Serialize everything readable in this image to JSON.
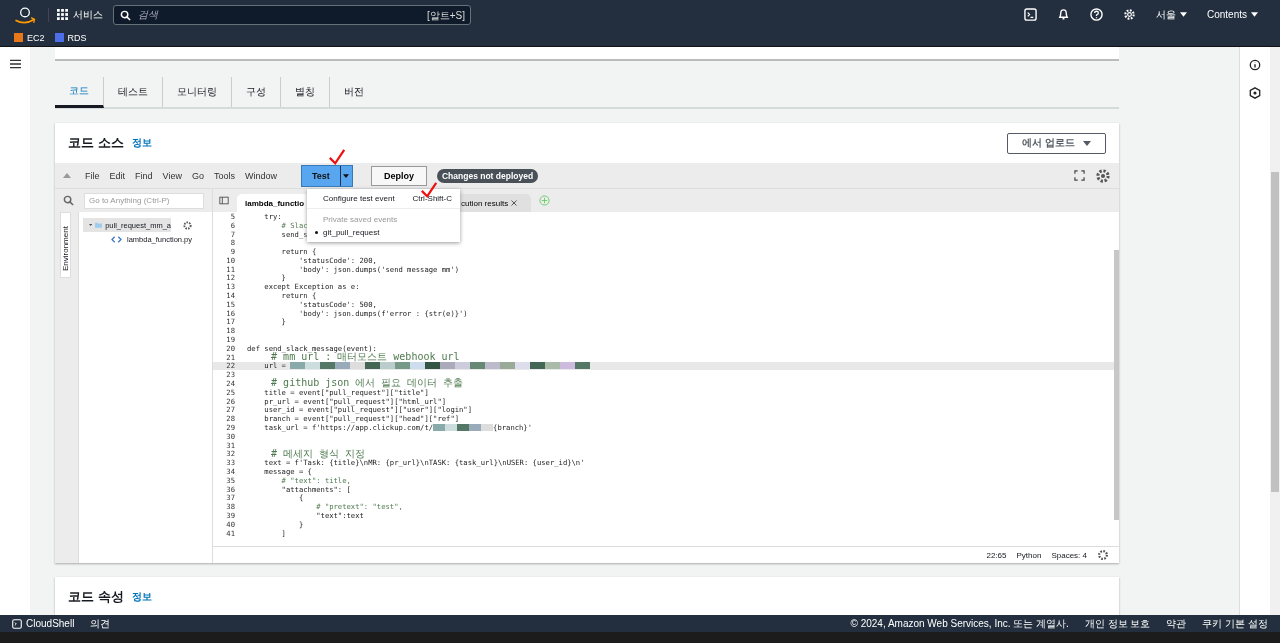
{
  "topbar": {
    "services": "서비스",
    "search_placeholder": "검색",
    "search_shortcut": "[알트+S]",
    "region": "서울",
    "account": "Contents"
  },
  "favorites": [
    {
      "label": "EC2",
      "color": "#e8771a"
    },
    {
      "label": "RDS",
      "color": "#4c6ee8"
    }
  ],
  "tabs": [
    {
      "label": "코드",
      "selected": true
    },
    {
      "label": "테스트",
      "selected": false
    },
    {
      "label": "모니터링",
      "selected": false
    },
    {
      "label": "구성",
      "selected": false
    },
    {
      "label": "별칭",
      "selected": false
    },
    {
      "label": "버전",
      "selected": false
    }
  ],
  "code_source": {
    "title": "코드 소스",
    "info": "정보",
    "upload_button": "에서 업로드"
  },
  "menu": [
    "File",
    "Edit",
    "Find",
    "View",
    "Go",
    "Tools",
    "Window"
  ],
  "test_button": "Test",
  "deploy_button": "Deploy",
  "status_badge": "Changes not deployed",
  "dropdown": {
    "item": "Configure test event",
    "shortcut": "Ctrl-Shift-C",
    "section": "Private saved events",
    "events": [
      "git_pull_request"
    ]
  },
  "goto_placeholder": "Go to Anything (Ctrl-P)",
  "environment_label": "Environment",
  "tree": [
    {
      "name": "pull_request_mm_a",
      "expanded": true,
      "children": [
        {
          "name": "lambda_function.py"
        }
      ]
    }
  ],
  "editor_tabs": [
    {
      "label": "lambda_functio",
      "selected": true
    },
    {
      "label": "cution results",
      "selected": false
    }
  ],
  "code_lines": [
    {
      "n": "5",
      "text": "    try:",
      "kind": "code"
    },
    {
      "n": "6",
      "text": "        # Slac",
      "kind": "comment"
    },
    {
      "n": "7",
      "text": "        send_s",
      "kind": "code"
    },
    {
      "n": "8",
      "kind": "code"
    },
    {
      "n": "9",
      "text": "        return {",
      "kind": "code"
    },
    {
      "n": "10",
      "text": "            'statusCode': 200,",
      "kind": "code"
    },
    {
      "n": "11",
      "text": "            'body': json.dumps('send message mm')",
      "kind": "code"
    },
    {
      "n": "12",
      "text": "        }",
      "kind": "code"
    },
    {
      "n": "13",
      "text": "    except Exception as e:",
      "kind": "code"
    },
    {
      "n": "14",
      "text": "        return {",
      "kind": "code"
    },
    {
      "n": "15",
      "text": "            'statusCode': 500,",
      "kind": "code"
    },
    {
      "n": "16",
      "text": "            'body': json.dumps(f'error : {str(e)}')",
      "kind": "code"
    },
    {
      "n": "17",
      "text": "        }",
      "kind": "code"
    },
    {
      "n": "18",
      "kind": "code"
    },
    {
      "n": "19",
      "kind": "code"
    },
    {
      "n": "20",
      "text": "def send_slack_message(event):",
      "kind": "code"
    },
    {
      "n": "21",
      "text": "    # mm url : 매터모스트 webhook url",
      "kind": "comment"
    },
    {
      "n": "22",
      "text": "    url = ",
      "kind": "redacted",
      "current": true
    },
    {
      "n": "23",
      "kind": "code"
    },
    {
      "n": "24",
      "text": "    # github json 에서 필요 데이터 추출",
      "kind": "comment"
    },
    {
      "n": "25",
      "text": "    title = event[\"pull_request\"][\"title\"]",
      "kind": "code"
    },
    {
      "n": "26",
      "text": "    pr_url = event[\"pull_request\"][\"html_url\"]",
      "kind": "code"
    },
    {
      "n": "27",
      "text": "    user_id = event[\"pull_request\"][\"user\"][\"login\"]",
      "kind": "code"
    },
    {
      "n": "28",
      "text": "    branch = event[\"pull_request\"][\"head\"][\"ref\"]",
      "kind": "code"
    },
    {
      "n": "29",
      "text": "    task_url = f'https://app.clickup.com/t/",
      "after": "{branch}'",
      "kind": "redacted"
    },
    {
      "n": "30",
      "kind": "code"
    },
    {
      "n": "31",
      "kind": "code"
    },
    {
      "n": "32",
      "text": "    # 메세지 형식 지정",
      "kind": "comment"
    },
    {
      "n": "33",
      "text": "    text = f'Task: {title}\\nMR: {pr_url}\\nTASK: {task_url}\\nUSER: {user_id}\\n'",
      "kind": "code"
    },
    {
      "n": "34",
      "text": "    message = {",
      "kind": "code"
    },
    {
      "n": "35",
      "text": "        # \"text\": title,",
      "kind": "comment"
    },
    {
      "n": "36",
      "text": "        \"attachments\": [",
      "kind": "code"
    },
    {
      "n": "37",
      "text": "            {",
      "kind": "code"
    },
    {
      "n": "38",
      "text": "                # \"pretext\": \"test\",",
      "kind": "comment"
    },
    {
      "n": "39",
      "text": "                \"text\":text",
      "kind": "code"
    },
    {
      "n": "40",
      "text": "            }",
      "kind": "code"
    },
    {
      "n": "41",
      "text": "        ]",
      "kind": "code"
    }
  ],
  "editor_status": {
    "position": "22:65",
    "language": "Python",
    "spaces": "Spaces: 4"
  },
  "code_properties": {
    "title": "코드 속성",
    "info": "정보"
  },
  "footer": {
    "cloudshell": "CloudShell",
    "feedback": "의견",
    "copyright": "© 2024, Amazon Web Services, Inc. 또는 계열사.",
    "links": [
      "개인 정보 보호",
      "약관",
      "쿠키 기본 설정"
    ]
  }
}
